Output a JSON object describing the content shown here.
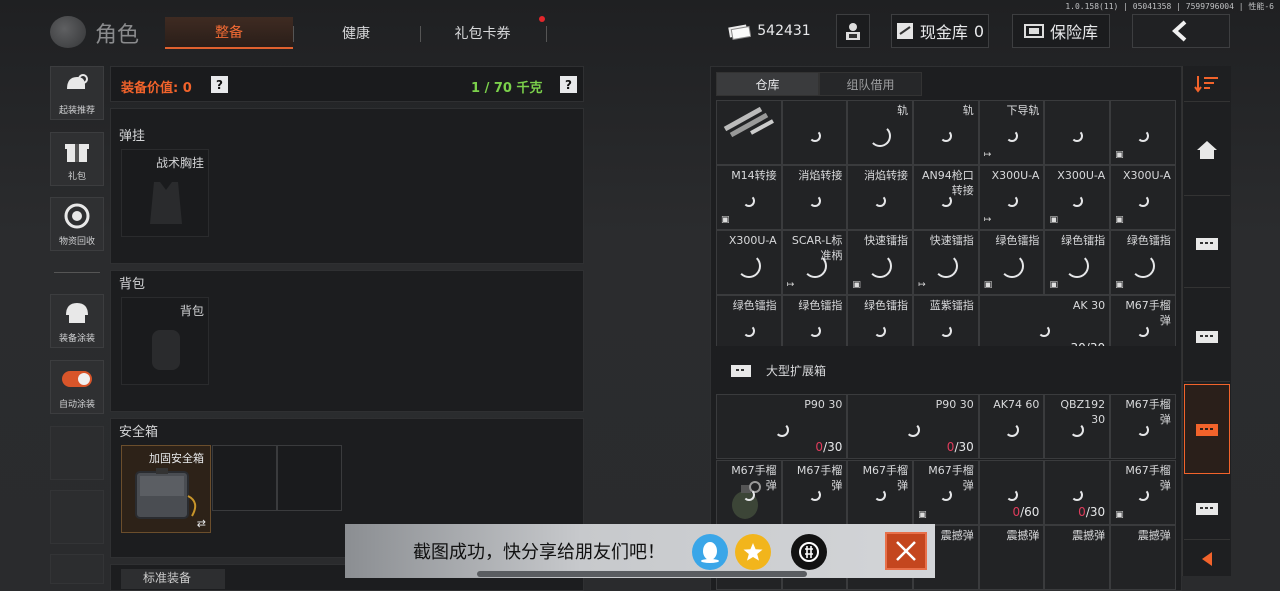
{
  "version_info": "1.0.158(11) | 05041358 | 7599796004 | 性能-6",
  "title": "角色",
  "tabs": [
    {
      "label": "整备",
      "active": true
    },
    {
      "label": "健康",
      "active": false
    },
    {
      "label": "礼包卡券",
      "active": false,
      "notification": true
    }
  ],
  "currency": {
    "amount": "542431"
  },
  "cash_storage": {
    "label": "现金库",
    "value": "0"
  },
  "safe_box_btn": {
    "label": "保险库"
  },
  "left_menu": [
    {
      "label": "起装推荐",
      "icon": "helmet-gear-icon"
    },
    {
      "label": "礼包",
      "icon": "gift-icon"
    },
    {
      "label": "物资回收",
      "icon": "recycle-icon"
    },
    {
      "label": "装备涂装",
      "icon": "paint-helmet-icon"
    },
    {
      "label": "自动涂装",
      "icon": "toggle-icon",
      "toggle_on": true
    }
  ],
  "loadout": {
    "value_label": "装备价值: 0",
    "weight_label": "1 / 70 千克",
    "chest_section": "弹挂",
    "chest_slot": "战术胸挂",
    "backpack_section": "背包",
    "backpack_slot": "背包",
    "safe_section": "安全箱",
    "safe_slot": "加固安全箱",
    "swap_symbol": "⇄",
    "bottom_section": "标准装备"
  },
  "storage_tabs": [
    {
      "label": "仓库",
      "active": true
    },
    {
      "label": "组队借用",
      "active": false
    }
  ],
  "warehouse_cells": [
    {
      "name": "",
      "kind": "rails"
    },
    {
      "name": "",
      "ring": 12
    },
    {
      "name": "轨",
      "ring": 22
    },
    {
      "name": "轨",
      "ring": 12
    },
    {
      "name": "下导轨",
      "ring": 12,
      "tag": "exit"
    },
    {
      "name": "",
      "ring": 12
    },
    {
      "name": "",
      "ring": 12,
      "tag": "box"
    },
    {
      "name": "M14转接",
      "ring": 12,
      "tag": "box"
    },
    {
      "name": "消焰转接",
      "ring": 12
    },
    {
      "name": "消焰转接",
      "ring": 12
    },
    {
      "name": "AN94枪口转接",
      "ring": 12
    },
    {
      "name": "X300U-A",
      "ring": 12,
      "tag": "exit"
    },
    {
      "name": "X300U-A",
      "ring": 12,
      "tag": "box"
    },
    {
      "name": "X300U-A",
      "ring": 12,
      "tag": "box"
    },
    {
      "name": "X300U-A",
      "ring": 24
    },
    {
      "name": "SCAR-L标准柄",
      "ring": 24,
      "tag": "exit"
    },
    {
      "name": "快速镭指",
      "ring": 24,
      "tag": "box"
    },
    {
      "name": "快速镭指",
      "ring": 24,
      "tag": "exit"
    },
    {
      "name": "绿色镭指",
      "ring": 24,
      "tag": "box"
    },
    {
      "name": "绿色镭指",
      "ring": 24,
      "tag": "box"
    },
    {
      "name": "绿色镭指",
      "ring": 24,
      "tag": "box"
    },
    {
      "name": "绿色镭指",
      "ring": 12,
      "tag": "box"
    },
    {
      "name": "绿色镭指",
      "ring": 12,
      "tag": "box"
    },
    {
      "name": "绿色镭指",
      "ring": 12
    },
    {
      "name": "蓝紫镭指",
      "ring": 12
    },
    {
      "name": "AK 30",
      "ring": 12,
      "count": "30/30",
      "wide": true
    },
    {
      "name": "M67手榴弹",
      "ring": 12
    }
  ],
  "expansion_box": {
    "label": "大型扩展箱"
  },
  "expansion_cells": [
    {
      "name": "P90 30",
      "ring": 14,
      "count_red": "0",
      "count_rest": "/30",
      "wide": true
    },
    {
      "name": "P90 30",
      "ring": 14,
      "count_red": "0",
      "count_rest": "/30",
      "wide": true
    },
    {
      "name": "AK74 60",
      "ring": 14
    },
    {
      "name": "QBZ192 30",
      "ring": 14
    },
    {
      "name": "M67手榴弹",
      "ring": 12
    },
    {
      "name": "M67手榴弹",
      "ring": 12,
      "kind": "grenade"
    },
    {
      "name": "M67手榴弹",
      "ring": 12
    },
    {
      "name": "M67手榴弹",
      "ring": 12
    },
    {
      "name": "M67手榴弹",
      "ring": 12,
      "tag": "box"
    },
    {
      "name": "",
      "ring": 12,
      "count_red": "0",
      "count_rest": "/60"
    },
    {
      "name": "",
      "ring": 12,
      "count_red": "0",
      "count_rest": "/30"
    },
    {
      "name": "M67手榴弹",
      "ring": 12,
      "tag": "box"
    },
    {
      "name": "",
      "ring": 0
    },
    {
      "name": "",
      "ring": 0
    },
    {
      "name": "",
      "ring": 0
    },
    {
      "name": "震撼弹",
      "ring": 0
    },
    {
      "name": "震撼弹",
      "ring": 0
    },
    {
      "name": "震撼弹",
      "ring": 0
    },
    {
      "name": "震撼弹",
      "ring": 0
    }
  ],
  "share_toast": {
    "text": "截图成功，快分享给朋友们吧！"
  },
  "colors": {
    "accent": "#f26b34",
    "green": "#7bd14b",
    "orange": "#f2632b",
    "red": "#e03c5c"
  }
}
